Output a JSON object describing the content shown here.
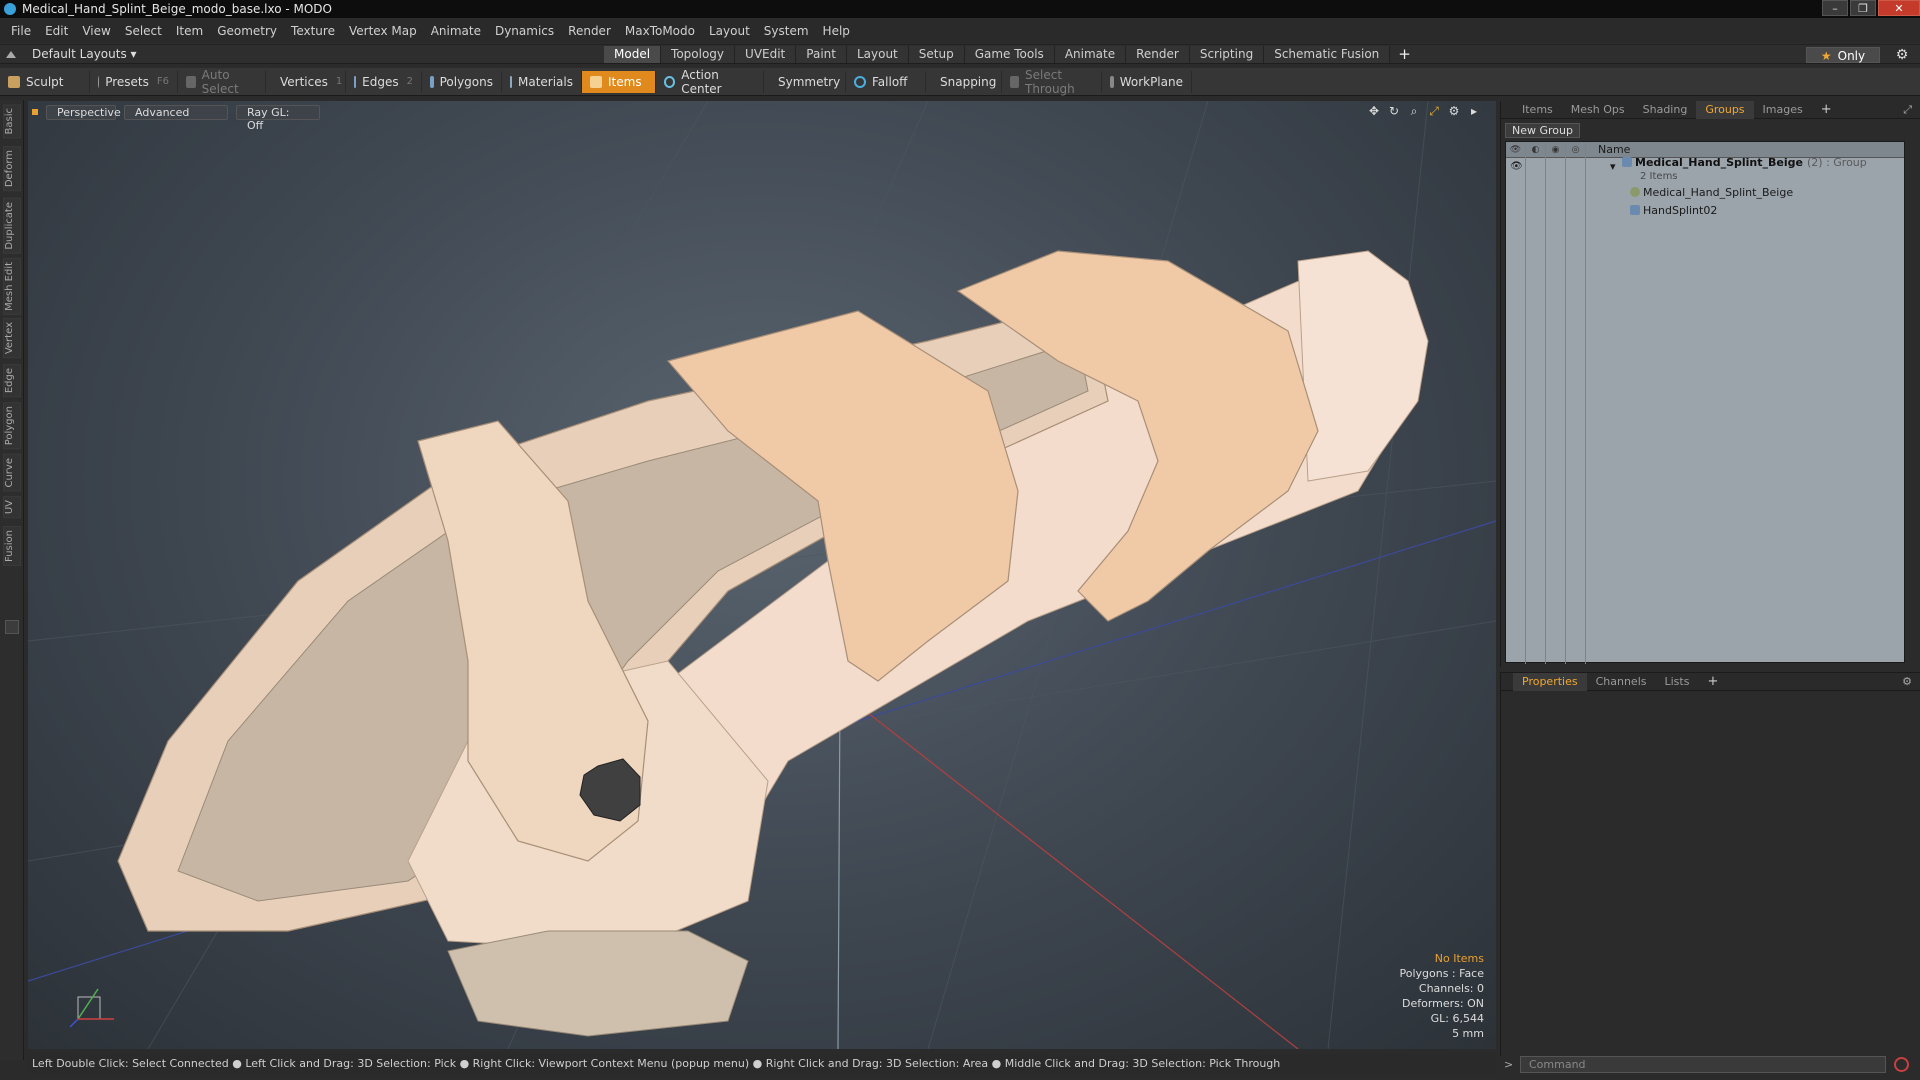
{
  "window": {
    "title": "Medical_Hand_Splint_Beige_modo_base.lxo - MODO",
    "controls": [
      "–",
      "❐",
      "✕"
    ]
  },
  "menu": [
    "File",
    "Edit",
    "View",
    "Select",
    "Item",
    "Geometry",
    "Texture",
    "Vertex Map",
    "Animate",
    "Dynamics",
    "Render",
    "MaxToModo",
    "Layout",
    "System",
    "Help"
  ],
  "layoutbar": {
    "layout_label": "Default Layouts ▾",
    "tabs": [
      "Model",
      "Topology",
      "UVEdit",
      "Paint",
      "Layout",
      "Setup",
      "Game Tools",
      "Animate",
      "Render",
      "Scripting",
      "Schematic Fusion"
    ],
    "active_tab": "Model",
    "plus": "+",
    "only_label": "Only",
    "star": "★"
  },
  "toolbar": {
    "sculpt": "Sculpt",
    "presets": "Presets",
    "presets_key": "F6",
    "auto_select": "Auto Select",
    "vertices": "Vertices",
    "vertices_key": "1",
    "edges": "Edges",
    "edges_key": "2",
    "polygons": "Polygons",
    "materials": "Materials",
    "items": "Items",
    "action_center": "Action Center",
    "symmetry": "Symmetry",
    "falloff": "Falloff",
    "snapping": "Snapping",
    "select_through": "Select Through",
    "workplane": "WorkPlane"
  },
  "left_tabs": [
    "Basic",
    "Deform",
    "Duplicate",
    "Mesh Edit",
    "Vertex",
    "Edge",
    "Polygon",
    "Curve",
    "UV",
    "Fusion"
  ],
  "viewport": {
    "perspective": "Perspective",
    "advanced": "Advanced",
    "raygl": "Ray GL: Off",
    "info": {
      "no_items": "No Items",
      "polygons": "Polygons : Face",
      "channels": "Channels: 0",
      "deformers": "Deformers: ON",
      "gl": "GL: 6,544",
      "scale": "5 mm"
    }
  },
  "groups_panel": {
    "tabs": [
      "Items",
      "Mesh Ops",
      "Shading",
      "Groups",
      "Images"
    ],
    "active_tab": "Groups",
    "new_group": "New Group",
    "name_header": "Name",
    "group": {
      "name": "Medical_Hand_Splint_Beige",
      "meta": "(2) : Group",
      "count": "2 Items",
      "children": [
        "Medical_Hand_Splint_Beige",
        "HandSplint02"
      ]
    }
  },
  "properties_panel": {
    "tabs": [
      "Properties",
      "Channels",
      "Lists"
    ],
    "active_tab": "Properties"
  },
  "command": {
    "placeholder": "Command"
  },
  "status_bar": "Left Double Click: Select Connected ● Left Click and Drag: 3D Selection: Pick ● Right Click: Viewport Context Menu (popup menu) ● Right Click and Drag: 3D Selection: Area ● Middle Click and Drag: 3D Selection: Pick Through",
  "colors": {
    "accent": "#e08a1e",
    "splint_beige": "#f2d2b4",
    "foam": "#c9b9a8"
  }
}
